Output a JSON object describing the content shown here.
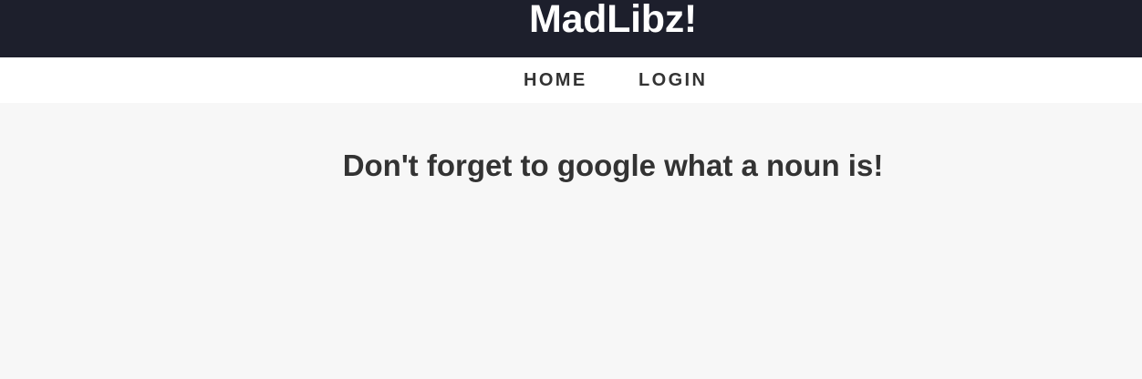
{
  "header": {
    "title": "MadLibz!",
    "background_color": "#1d1f2c",
    "title_color": "#ffffff"
  },
  "nav": {
    "items": [
      {
        "label": "HOME"
      },
      {
        "label": "LOGIN"
      }
    ],
    "background_color": "#ffffff",
    "text_color": "#333333"
  },
  "main": {
    "heading": "Don't forget to google what a noun is!",
    "background_color": "#f7f7f7",
    "text_color": "#333333"
  }
}
